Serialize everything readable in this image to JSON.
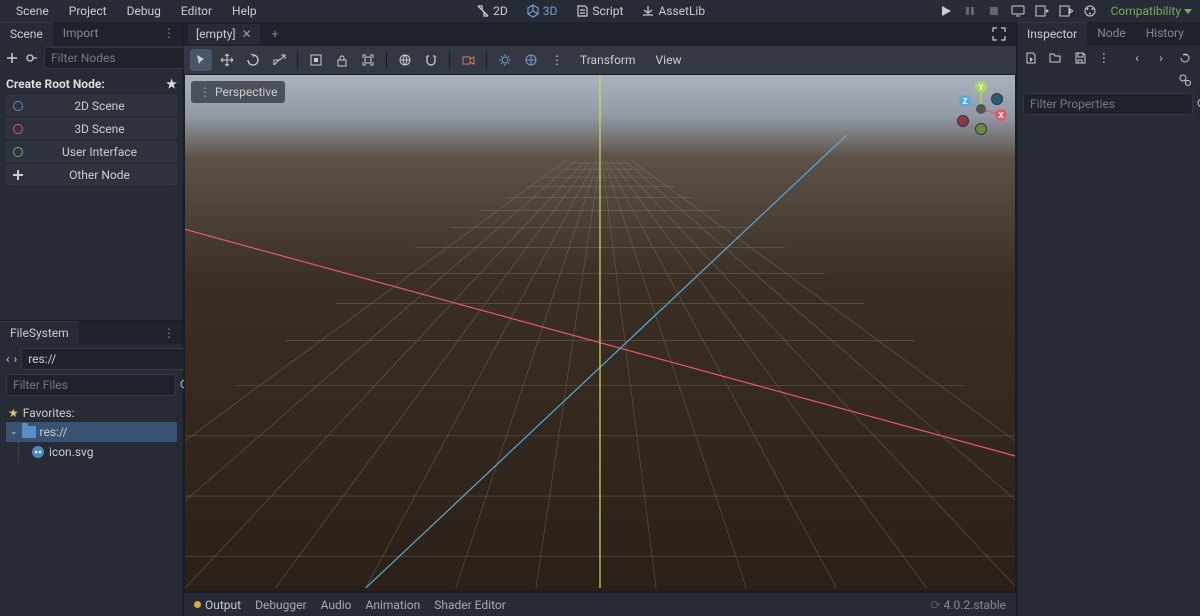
{
  "menu": {
    "items": [
      "Scene",
      "Project",
      "Debug",
      "Editor",
      "Help"
    ]
  },
  "mainTabs": {
    "t2d": "2D",
    "t3d": "3D",
    "script": "Script",
    "assetlib": "AssetLib"
  },
  "renderer": "Compatibility",
  "leftDock": {
    "sceneTab": "Scene",
    "importTab": "Import",
    "filterNodes": "Filter Nodes",
    "createRoot": "Create Root Node:",
    "rootOptions": {
      "scene2d": "2D Scene",
      "scene3d": "3D Scene",
      "ui": "User Interface",
      "other": "Other Node"
    }
  },
  "filesystem": {
    "title": "FileSystem",
    "path": "res://",
    "filter": "Filter Files",
    "favorites": "Favorites:",
    "root": "res://",
    "file": "icon.svg"
  },
  "sceneTabs": {
    "empty": "[empty]"
  },
  "viewportToolbar": {
    "transform": "Transform",
    "view": "View",
    "perspective": "Perspective"
  },
  "gizmo": {
    "x": "X",
    "y": "Y",
    "z": "Z"
  },
  "bottom": {
    "output": "Output",
    "debugger": "Debugger",
    "audio": "Audio",
    "animation": "Animation",
    "shader": "Shader Editor",
    "version": "4.0.2.stable"
  },
  "inspector": {
    "tab": "Inspector",
    "nodeTab": "Node",
    "historyTab": "History",
    "filter": "Filter Properties"
  }
}
